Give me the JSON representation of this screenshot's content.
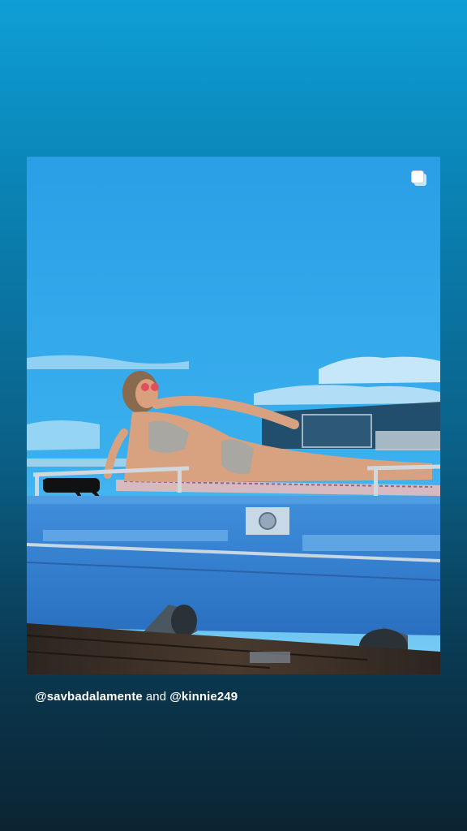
{
  "story": {
    "post": {
      "multi_photo_icon": "stacked-squares-icon",
      "image_description_colors": {
        "sky_top": "#2a9fe6",
        "sky_bottom": "#6cc7f2",
        "boat_blue": "#2f7fd0",
        "deck_wood": "#3a2e26"
      }
    },
    "caption": {
      "mention_1": "@savbadalamente",
      "conjunction": "and",
      "mention_2": "@kinnie249"
    }
  }
}
